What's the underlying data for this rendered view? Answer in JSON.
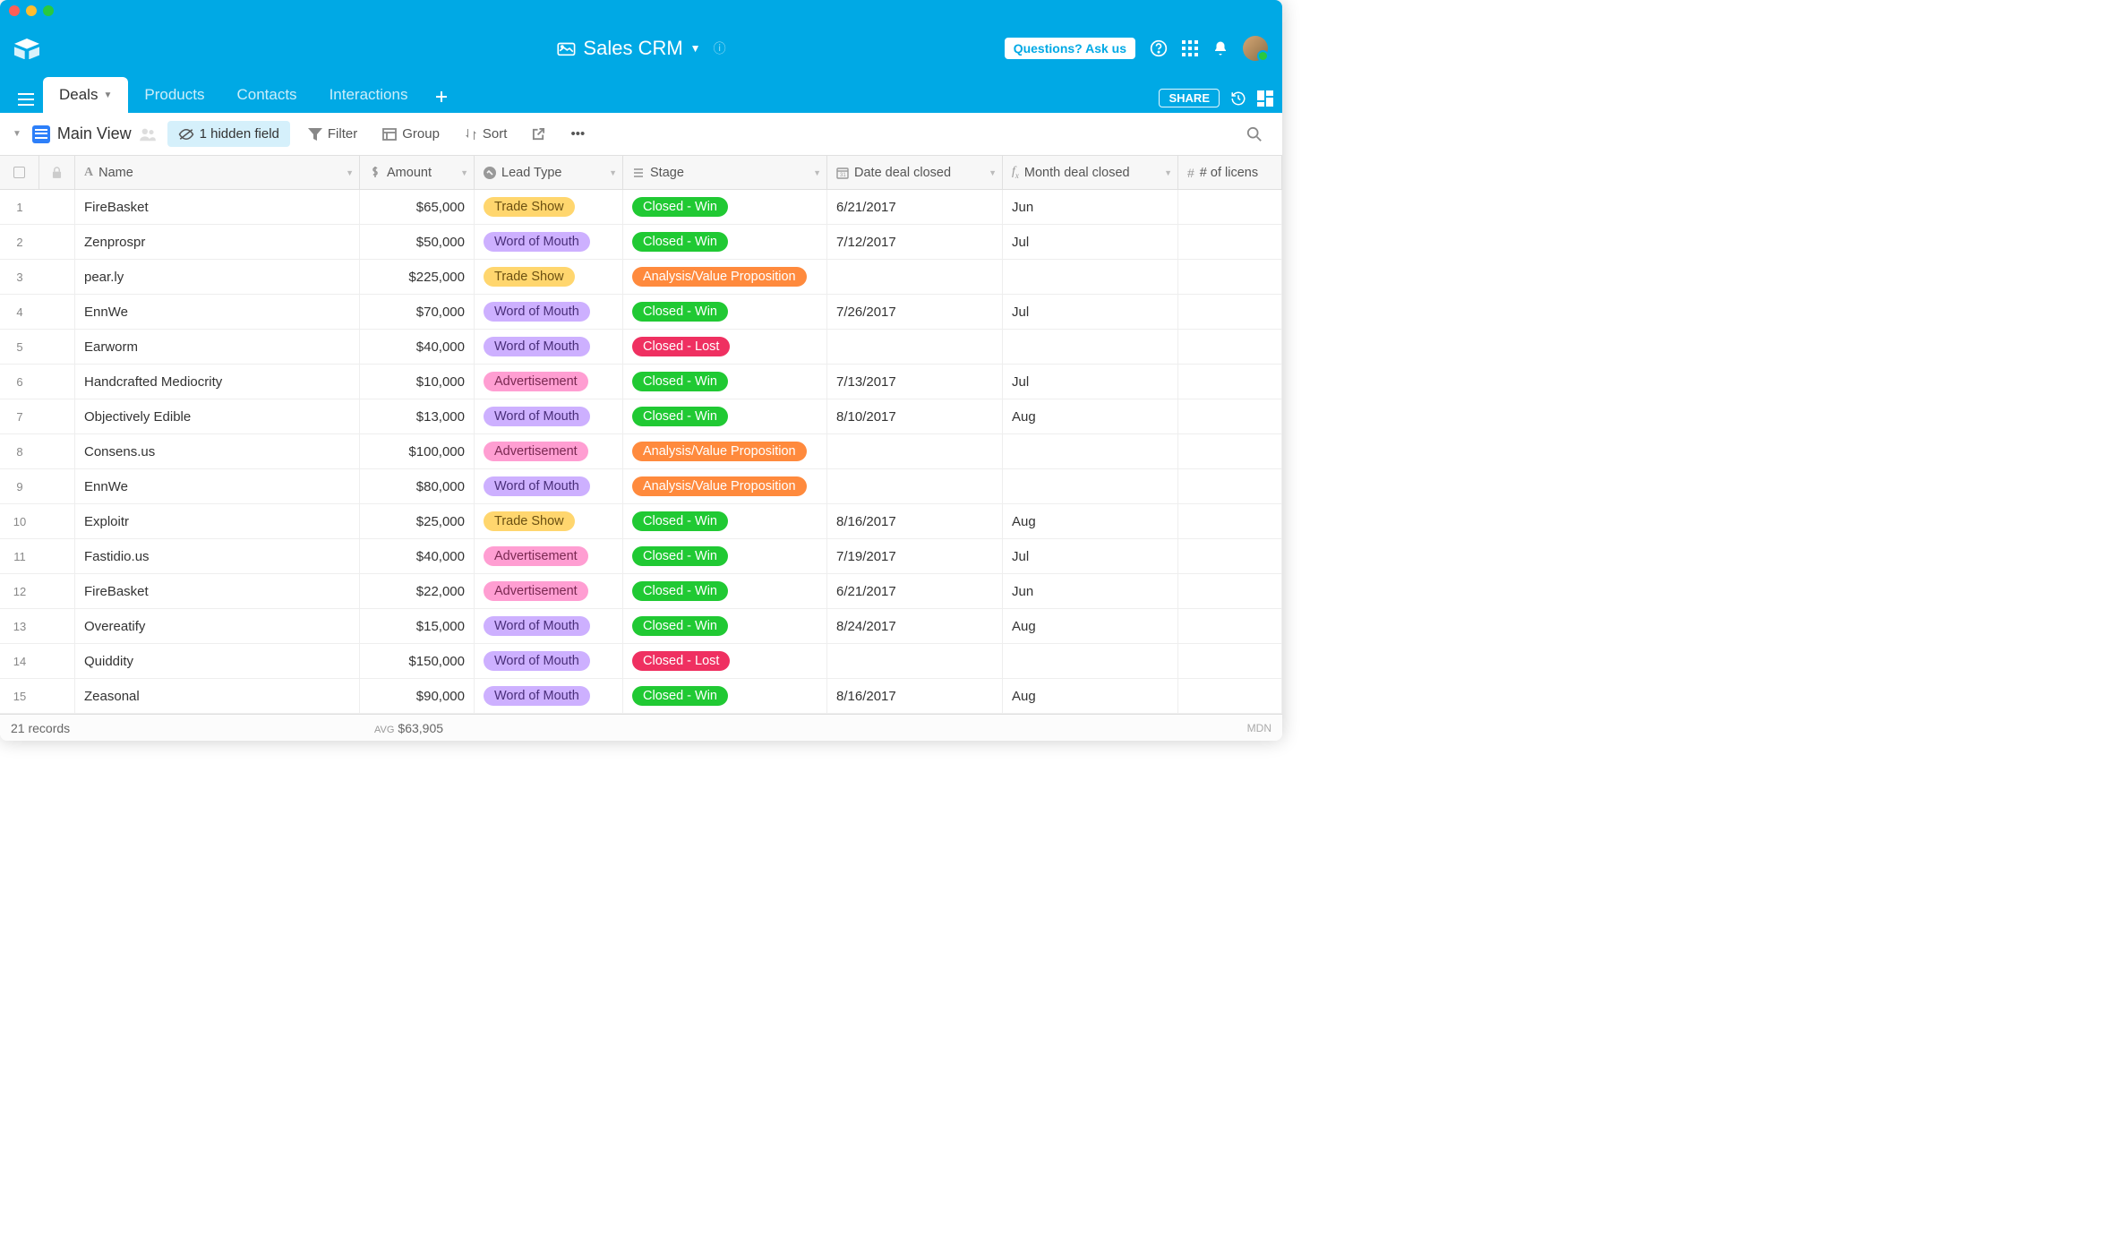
{
  "app": {
    "title": "Sales CRM",
    "questions_btn": "Questions? Ask us"
  },
  "tabs": [
    "Deals",
    "Products",
    "Contacts",
    "Interactions"
  ],
  "active_tab": 0,
  "share_btn": "SHARE",
  "view": {
    "name": "Main View",
    "hidden_fields": "1 hidden field",
    "filter": "Filter",
    "group": "Group",
    "sort": "Sort"
  },
  "columns": {
    "name": "Name",
    "amount": "Amount",
    "lead": "Lead Type",
    "stage": "Stage",
    "date": "Date deal closed",
    "month": "Month deal closed",
    "licenses": "# of licens"
  },
  "lead_colors": {
    "Trade Show": "pill-trade",
    "Word of Mouth": "pill-word",
    "Advertisement": "pill-ad"
  },
  "stage_colors": {
    "Closed - Win": "pill-win",
    "Closed - Lost": "pill-lost",
    "Analysis/Value Proposition": "pill-analysis"
  },
  "rows": [
    {
      "n": 1,
      "name": "FireBasket",
      "amount": "$65,000",
      "lead": "Trade Show",
      "stage": "Closed - Win",
      "date": "6/21/2017",
      "month": "Jun"
    },
    {
      "n": 2,
      "name": "Zenprospr",
      "amount": "$50,000",
      "lead": "Word of Mouth",
      "stage": "Closed - Win",
      "date": "7/12/2017",
      "month": "Jul"
    },
    {
      "n": 3,
      "name": "pear.ly",
      "amount": "$225,000",
      "lead": "Trade Show",
      "stage": "Analysis/Value Proposition",
      "date": "",
      "month": ""
    },
    {
      "n": 4,
      "name": "EnnWe",
      "amount": "$70,000",
      "lead": "Word of Mouth",
      "stage": "Closed - Win",
      "date": "7/26/2017",
      "month": "Jul"
    },
    {
      "n": 5,
      "name": "Earworm",
      "amount": "$40,000",
      "lead": "Word of Mouth",
      "stage": "Closed - Lost",
      "date": "",
      "month": ""
    },
    {
      "n": 6,
      "name": "Handcrafted Mediocrity",
      "amount": "$10,000",
      "lead": "Advertisement",
      "stage": "Closed - Win",
      "date": "7/13/2017",
      "month": "Jul"
    },
    {
      "n": 7,
      "name": "Objectively Edible",
      "amount": "$13,000",
      "lead": "Word of Mouth",
      "stage": "Closed - Win",
      "date": "8/10/2017",
      "month": "Aug"
    },
    {
      "n": 8,
      "name": "Consens.us",
      "amount": "$100,000",
      "lead": "Advertisement",
      "stage": "Analysis/Value Proposition",
      "date": "",
      "month": ""
    },
    {
      "n": 9,
      "name": "EnnWe",
      "amount": "$80,000",
      "lead": "Word of Mouth",
      "stage": "Analysis/Value Proposition",
      "date": "",
      "month": ""
    },
    {
      "n": 10,
      "name": "Exploitr",
      "amount": "$25,000",
      "lead": "Trade Show",
      "stage": "Closed - Win",
      "date": "8/16/2017",
      "month": "Aug"
    },
    {
      "n": 11,
      "name": "Fastidio.us",
      "amount": "$40,000",
      "lead": "Advertisement",
      "stage": "Closed - Win",
      "date": "7/19/2017",
      "month": "Jul"
    },
    {
      "n": 12,
      "name": "FireBasket",
      "amount": "$22,000",
      "lead": "Advertisement",
      "stage": "Closed - Win",
      "date": "6/21/2017",
      "month": "Jun"
    },
    {
      "n": 13,
      "name": "Overeatify",
      "amount": "$15,000",
      "lead": "Word of Mouth",
      "stage": "Closed - Win",
      "date": "8/24/2017",
      "month": "Aug"
    },
    {
      "n": 14,
      "name": "Quiddity",
      "amount": "$150,000",
      "lead": "Word of Mouth",
      "stage": "Closed - Lost",
      "date": "",
      "month": ""
    },
    {
      "n": 15,
      "name": "Zeasonal",
      "amount": "$90,000",
      "lead": "Word of Mouth",
      "stage": "Closed - Win",
      "date": "8/16/2017",
      "month": "Aug"
    }
  ],
  "footer": {
    "records": "21 records",
    "avg_label": "AVG",
    "avg_value": "$63,905",
    "mdn": "MDN"
  }
}
